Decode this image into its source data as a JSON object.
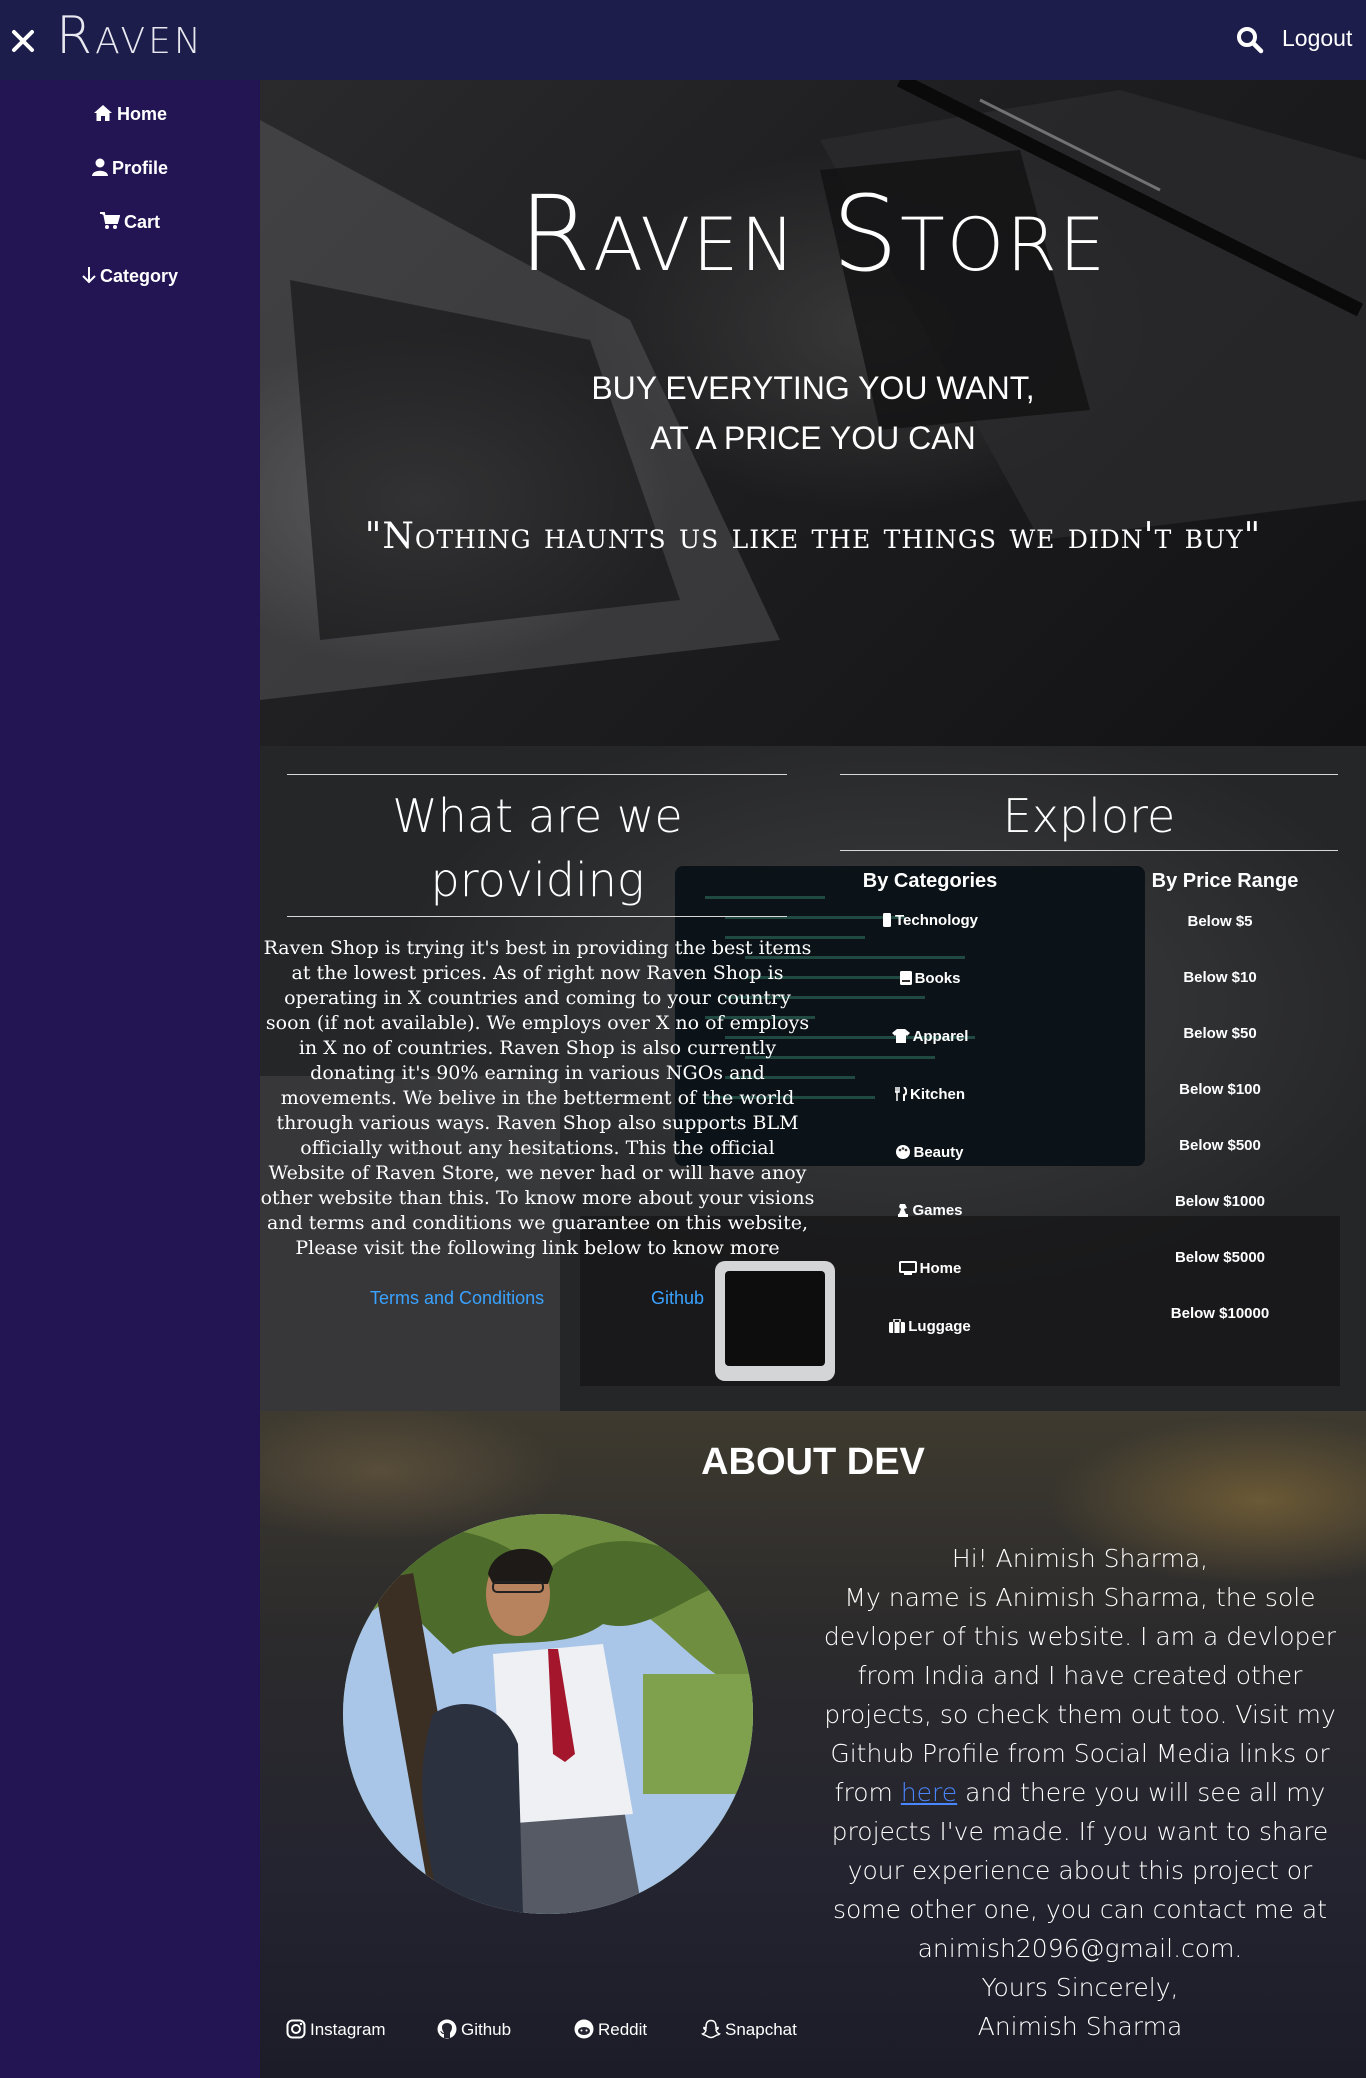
{
  "header": {
    "brand": "Raven",
    "logout_label": "Logout",
    "icons": [
      "close-icon",
      "search-icon"
    ]
  },
  "sidebar": {
    "items": [
      {
        "label": "Home",
        "icon": "home-icon"
      },
      {
        "label": "Profile",
        "icon": "user-icon"
      },
      {
        "label": "Cart",
        "icon": "cart-icon"
      },
      {
        "label": "Category",
        "icon": "arrow-down-icon"
      }
    ]
  },
  "hero": {
    "title": "Raven Store",
    "subtitle_line1": "BUY EVERYTING YOU WANT,",
    "subtitle_line2": "AT A PRICE YOU CAN",
    "quote": "\"Nothing haunts us like the things we didn't buy\""
  },
  "providing": {
    "title_line1": "What are we",
    "title_line2": "providing",
    "body": "Raven Shop is trying it's best in providing the best items at the lowest prices. As of right now Raven Shop is operating in X countries and coming to your country soon (if not available). We employs over X no of employs in X no of countries. Raven Shop is also currently donating it's 90% earning in various NGOs and movements. We belive in the betterment of the world through various ways. Raven Shop also supports BLM officially without any hesitations. This the official Website of Raven Store, we never had or will have anoy other website than this. To know more about your visions and terms and conditions we guarantee on this website, Please visit the following link below to know more",
    "link_terms": "Terms and Conditions",
    "link_github": "Github"
  },
  "explore": {
    "title": "Explore",
    "categories_heading": "By Categories",
    "price_heading": "By Price Range",
    "categories": [
      {
        "label": "Technology",
        "icon": "mobile-icon"
      },
      {
        "label": "Books",
        "icon": "book-icon"
      },
      {
        "label": "Apparel",
        "icon": "shirt-icon"
      },
      {
        "label": "Kitchen",
        "icon": "utensils-icon"
      },
      {
        "label": "Beauty",
        "icon": "palette-icon"
      },
      {
        "label": "Games",
        "icon": "chess-icon"
      },
      {
        "label": "Home",
        "icon": "monitor-icon"
      },
      {
        "label": "Luggage",
        "icon": "suitcase-icon"
      }
    ],
    "prices": [
      "Below $5",
      "Below $10",
      "Below $50",
      "Below $100",
      "Below $500",
      "Below $1000",
      "Below $5000",
      "Below $10000"
    ]
  },
  "dev": {
    "title": "ABOUT DEV",
    "greeting": "Hi! Animish Sharma,",
    "body_before_link": "My name is Animish Sharma, the sole devloper of this website. I am a devloper from India and I have created other projects, so check them out too. Visit my Github Profile from Social Media links or from",
    "link_text": "here",
    "body_after_link": "and there you will see all my projects I've made. If you want to share your experience about this project or some other one, you can contact me at",
    "email": "animish2096@gmail.com.",
    "signoff": "Yours Sincerely,",
    "signature": "Animish Sharma",
    "social": [
      {
        "label": "Instagram",
        "icon": "instagram-icon"
      },
      {
        "label": "Github",
        "icon": "github-icon"
      },
      {
        "label": "Reddit",
        "icon": "reddit-icon"
      },
      {
        "label": "Snapchat",
        "icon": "snapchat-icon"
      }
    ]
  },
  "colors": {
    "topbar": "#1d1d4b",
    "sidebar": "#231554",
    "link": "#3aa2ff"
  }
}
